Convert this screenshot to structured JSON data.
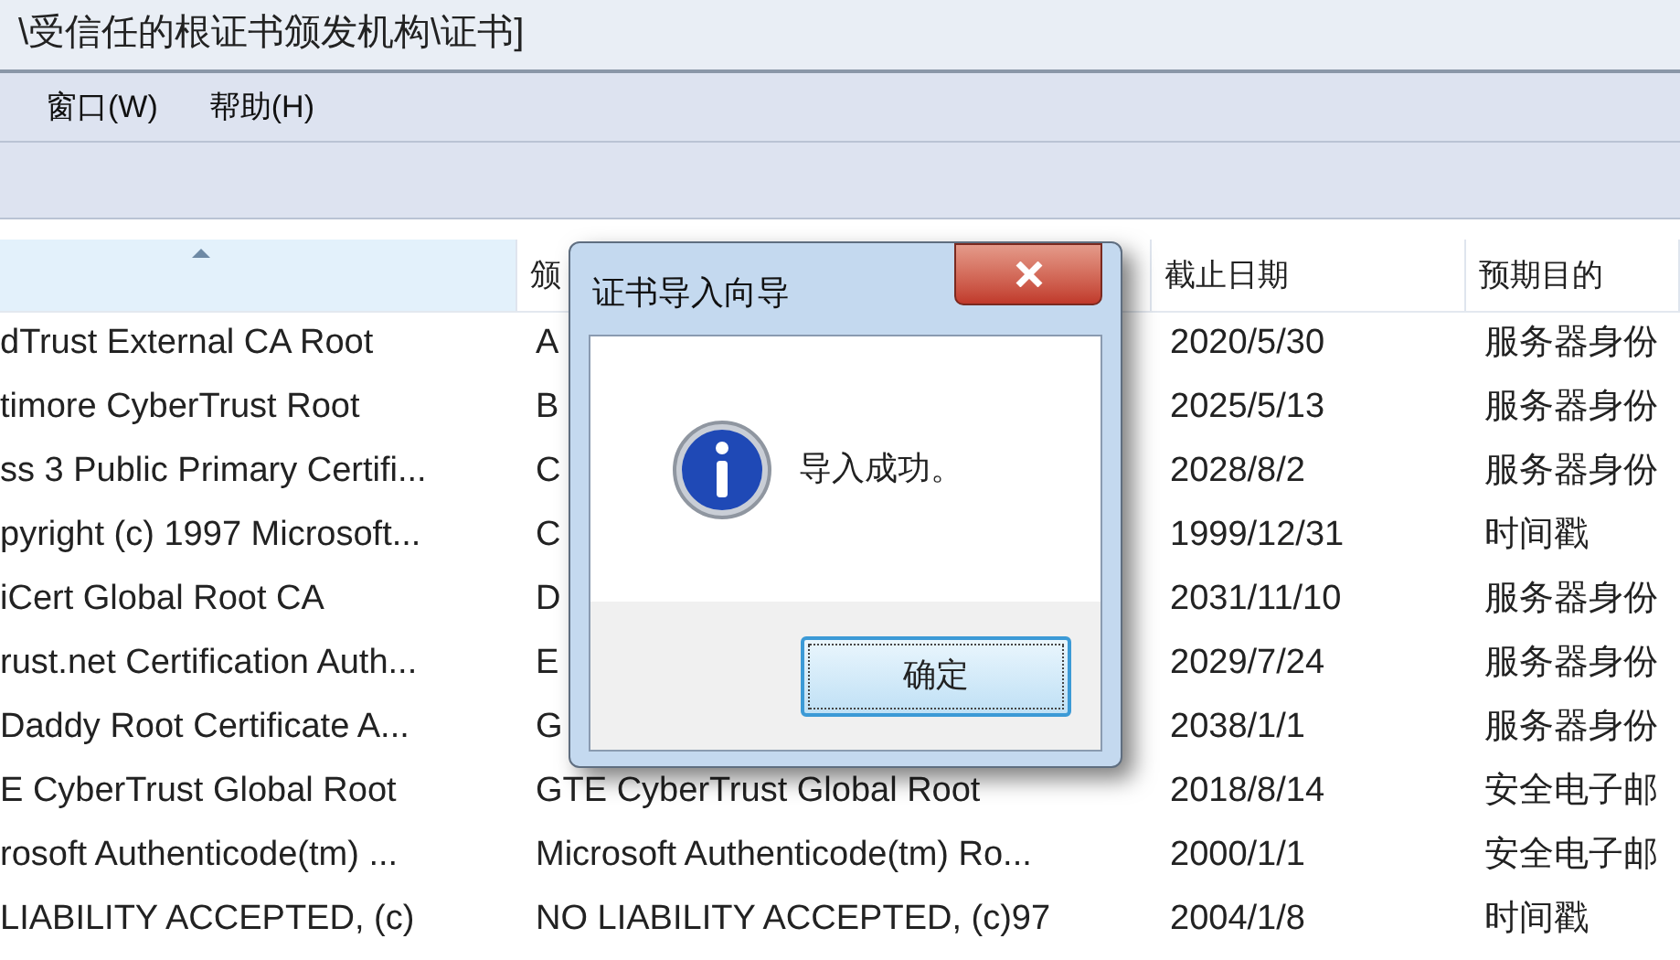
{
  "window": {
    "title": "\\受信任的根证书颁发机构\\证书]"
  },
  "menu": [
    "窗口(W)",
    "帮助(H)"
  ],
  "table": {
    "columns": [
      {
        "sorted": true
      },
      {
        "label": "颁",
        "sorted": false
      },
      {
        "label": "截止日期",
        "sorted": false
      },
      {
        "label": "预期目的",
        "sorted": false
      }
    ],
    "rows": [
      [
        "dTrust External CA Root",
        "A",
        "2020/5/30",
        "服务器身份"
      ],
      [
        "timore CyberTrust Root",
        "B",
        "2025/5/13",
        "服务器身份"
      ],
      [
        "ss 3 Public Primary Certifi...",
        "C",
        "2028/8/2",
        "服务器身份"
      ],
      [
        "pyright (c) 1997 Microsoft...",
        "C",
        "1999/12/31",
        "时间戳"
      ],
      [
        "iCert Global Root CA",
        "D",
        "2031/11/10",
        "服务器身份"
      ],
      [
        "rust.net Certification Auth...",
        "E",
        "2029/7/24",
        "服务器身份"
      ],
      [
        "Daddy Root Certificate A...",
        "G",
        "2038/1/1",
        "服务器身份"
      ],
      [
        "E CyberTrust Global Root",
        "GTE CyberTrust Global Root",
        "2018/8/14",
        "安全电子邮"
      ],
      [
        "rosoft Authenticode(tm) ...",
        "Microsoft Authenticode(tm) Ro...",
        "2000/1/1",
        "安全电子邮"
      ],
      [
        "LIABILITY ACCEPTED, (c)",
        "NO LIABILITY ACCEPTED, (c)97",
        "2004/1/8",
        "时间戳"
      ]
    ]
  },
  "dialog": {
    "title": "证书导入向导",
    "message": "导入成功。",
    "button": "确定"
  }
}
